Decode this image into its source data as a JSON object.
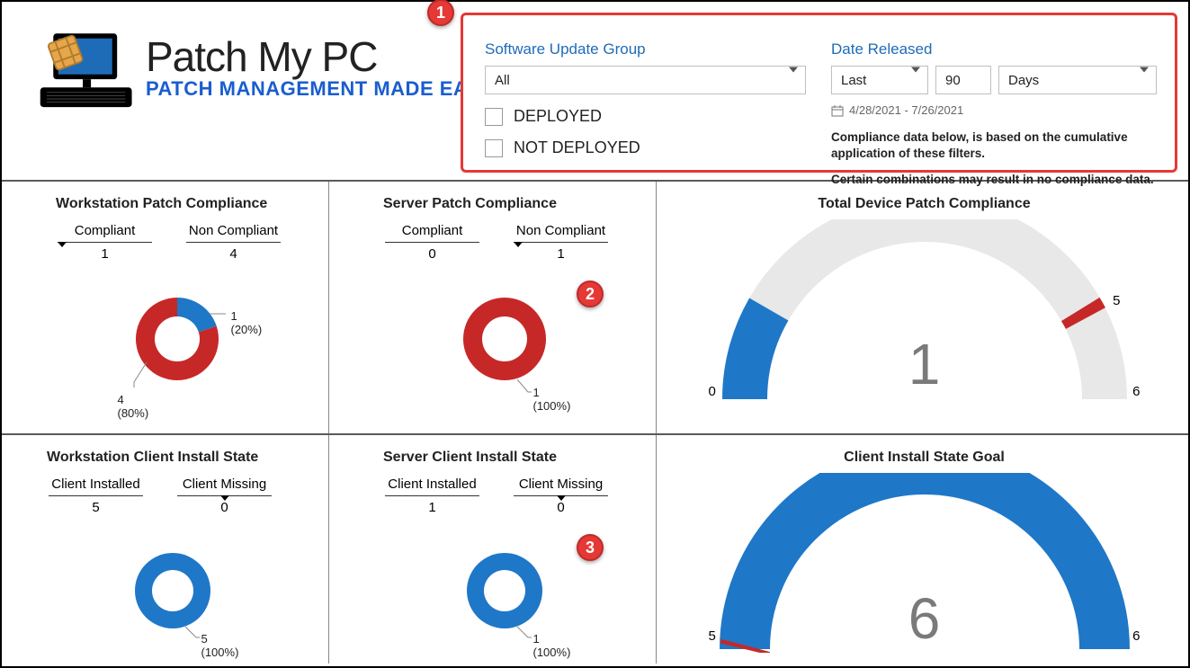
{
  "logo": {
    "brand": "Patch My PC",
    "tagline": "PATCH MANAGEMENT MADE EASY"
  },
  "filters": {
    "sug_label": "Software Update Group",
    "sug_value": "All",
    "date_label": "Date Released",
    "period_value": "Last",
    "number_value": "90",
    "unit_value": "Days",
    "cb_deployed": "DEPLOYED",
    "cb_not_deployed": "NOT DEPLOYED",
    "date_range": "4/28/2021 - 7/26/2021",
    "info_text": "Compliance data below, is based on the cumulative application of these filters.",
    "info_text2": "Certain combinations may result in no compliance data."
  },
  "markers": {
    "m1": "1",
    "m2": "2",
    "m3": "3"
  },
  "tiles": {
    "wpc": {
      "title": "Workstation Patch Compliance",
      "headers": [
        "Compliant",
        "Non Compliant"
      ],
      "values": [
        "1",
        "4"
      ],
      "label1": "1 (20%)",
      "label2": "4 (80%)"
    },
    "spc": {
      "title": "Server Patch Compliance",
      "headers": [
        "Compliant",
        "Non Compliant"
      ],
      "values": [
        "0",
        "1"
      ],
      "label1": "1 (100%)"
    },
    "tdpc": {
      "title": "Total Device Patch Compliance",
      "scale_l": "0",
      "scale_r": "6",
      "tick": "5",
      "value": "1"
    },
    "wcis": {
      "title": "Workstation Client Install State",
      "headers": [
        "Client Installed",
        "Client Missing"
      ],
      "values": [
        "5",
        "0"
      ],
      "label1": "5 (100%)"
    },
    "scis": {
      "title": "Server Client Install State",
      "headers": [
        "Client Installed",
        "Client Missing"
      ],
      "values": [
        "1",
        "0"
      ],
      "label1": "1 (100%)"
    },
    "cisg": {
      "title": "Client Install State Goal",
      "scale_l": "5",
      "scale_r": "6",
      "value": "6"
    }
  },
  "chart_data": [
    {
      "type": "pie",
      "title": "Workstation Patch Compliance",
      "categories": [
        "Compliant",
        "Non Compliant"
      ],
      "values": [
        1,
        4
      ],
      "colors": [
        "#1f77c8",
        "#c62828"
      ]
    },
    {
      "type": "pie",
      "title": "Server Patch Compliance",
      "categories": [
        "Compliant",
        "Non Compliant"
      ],
      "values": [
        0,
        1
      ],
      "colors": [
        "#1f77c8",
        "#c62828"
      ]
    },
    {
      "type": "gauge",
      "title": "Total Device Patch Compliance",
      "value": 1,
      "range": [
        0,
        6
      ],
      "tick": 5
    },
    {
      "type": "pie",
      "title": "Workstation Client Install State",
      "categories": [
        "Client Installed",
        "Client Missing"
      ],
      "values": [
        5,
        0
      ],
      "colors": [
        "#1f77c8",
        "#c62828"
      ]
    },
    {
      "type": "pie",
      "title": "Server Client Install State",
      "categories": [
        "Client Installed",
        "Client Missing"
      ],
      "values": [
        1,
        0
      ],
      "colors": [
        "#1f77c8",
        "#c62828"
      ]
    },
    {
      "type": "gauge",
      "title": "Client Install State Goal",
      "value": 6,
      "range": [
        5,
        6
      ]
    }
  ]
}
